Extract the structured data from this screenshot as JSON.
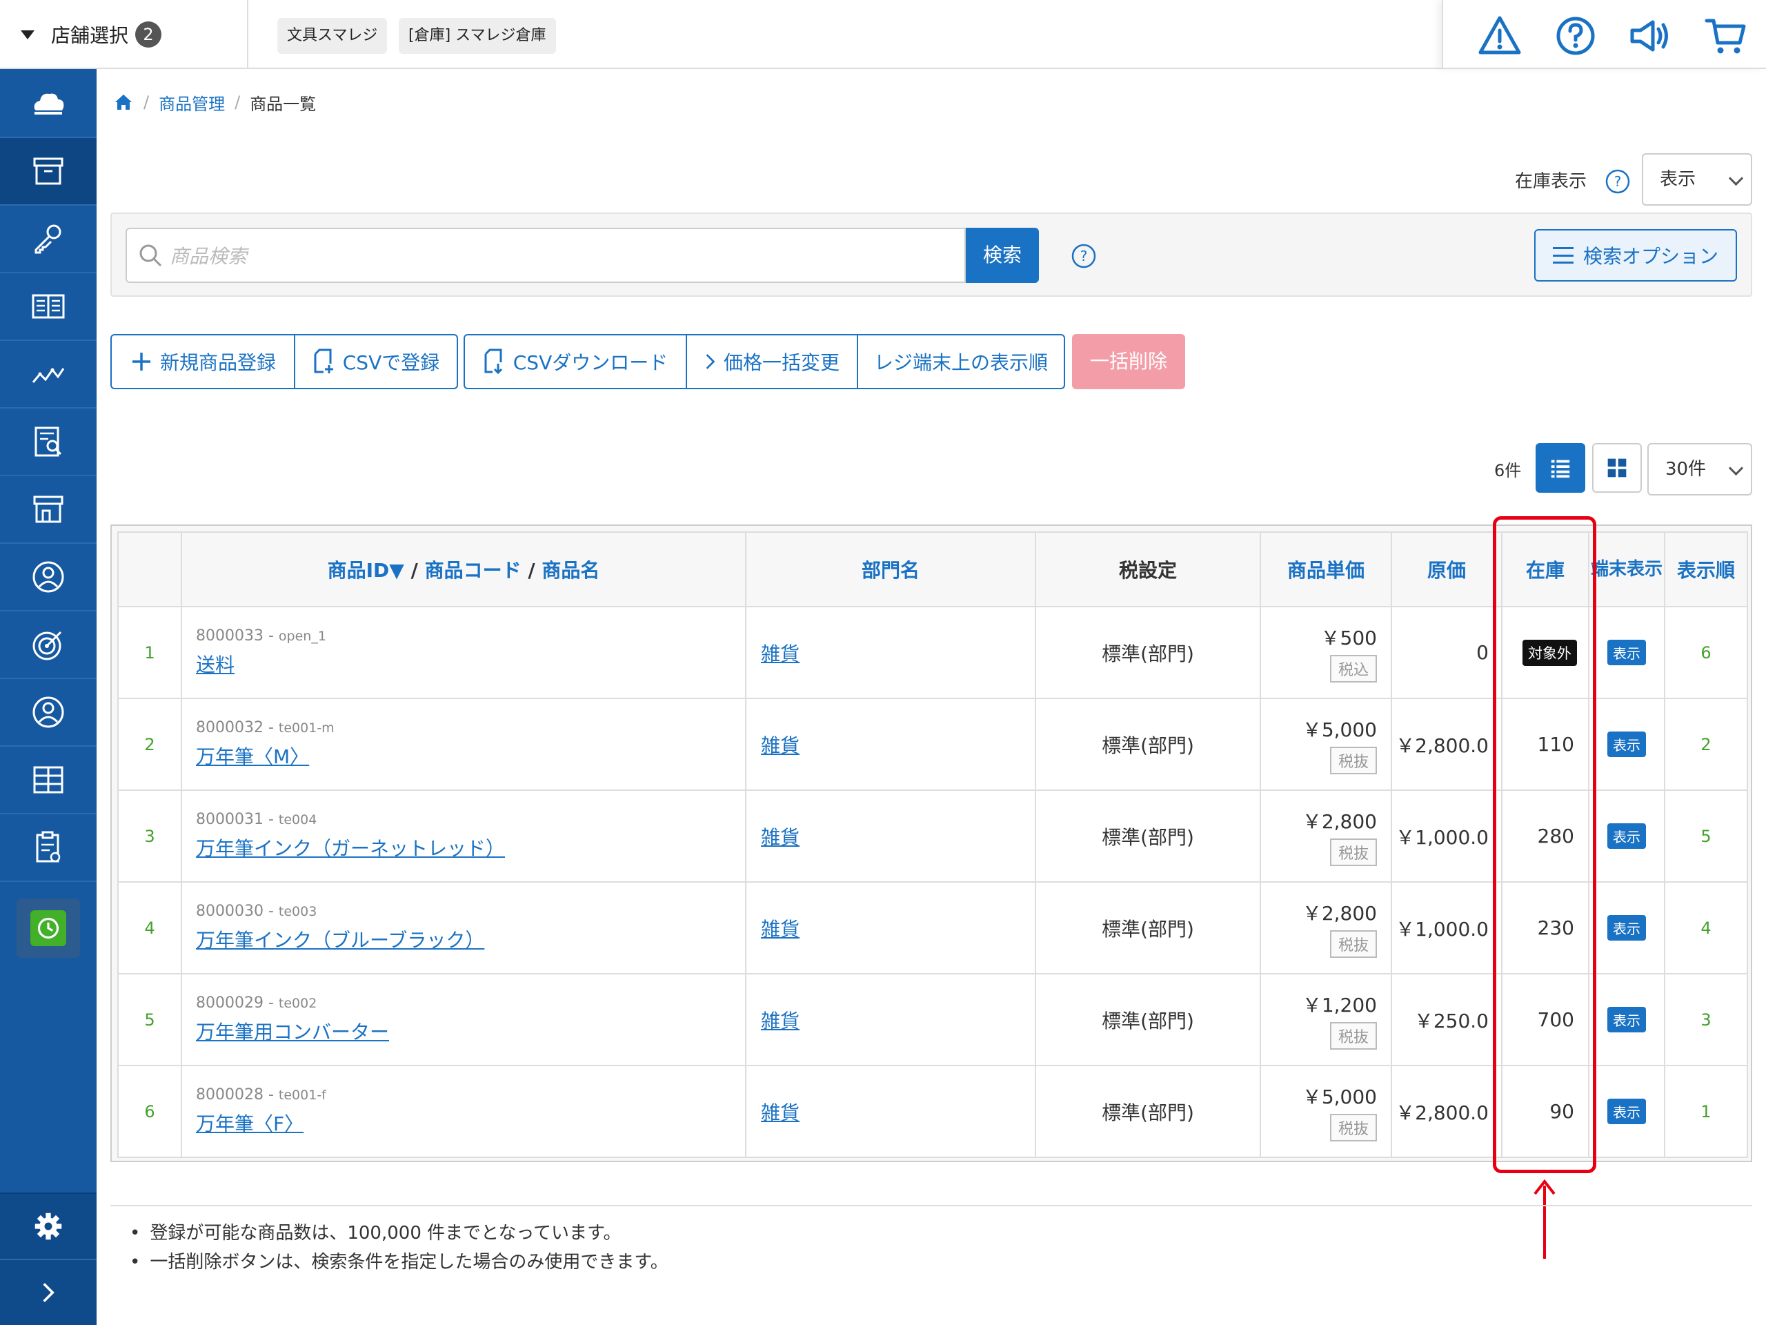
{
  "header": {
    "store_select_label": "店舗選択",
    "store_count": "2",
    "stores": [
      "文具スマレジ",
      "[倉庫] スマレジ倉庫"
    ],
    "icons": [
      "warning-icon",
      "help-icon",
      "announce-icon",
      "cart-icon"
    ]
  },
  "sidebar": {
    "items": [
      "cloud-icon",
      "box-icon",
      "key-icon",
      "book-icon",
      "chart-icon",
      "report-icon",
      "store-icon",
      "staff-icon",
      "target-icon",
      "customer-icon",
      "grid-icon",
      "clipboard-icon",
      "clock-icon"
    ],
    "active": "box-icon",
    "bottom": [
      "gear-icon",
      "chevron-right-icon"
    ]
  },
  "breadcrumb": {
    "home_icon": "home-icon",
    "items": [
      "商品管理",
      "商品一覧"
    ]
  },
  "stock_display": {
    "label": "在庫表示",
    "value": "表示"
  },
  "search": {
    "placeholder": "商品検索",
    "button": "検索",
    "options_button": "検索オプション"
  },
  "actions": {
    "new_product": "新規商品登録",
    "csv_register": "CSVで登録",
    "csv_download": "CSVダウンロード",
    "price_bulk": "価格一括変更",
    "register_order": "レジ端末上の表示順",
    "bulk_delete": "一括削除"
  },
  "list": {
    "count": "6件",
    "per_page": "30件"
  },
  "table": {
    "headers": {
      "id": "商品ID▼",
      "code": "商品コード",
      "name": "商品名",
      "sep": "/",
      "dept": "部門名",
      "tax": "税設定",
      "price": "商品単価",
      "cost": "原価",
      "stock": "在庫",
      "terminal": "端末表示",
      "order": "表示順"
    },
    "rows": [
      {
        "no": "1",
        "id": "8000033",
        "code": "open_1",
        "name": "送料",
        "dept": "雑貨",
        "tax": "標準(部門)",
        "price": "￥500",
        "tax_type": "税込",
        "cost": "0",
        "stock": "",
        "stock_badge": "対象外",
        "terminal": "表示",
        "order": "6"
      },
      {
        "no": "2",
        "id": "8000032",
        "code": "te001-m",
        "name": "万年筆〈M〉",
        "dept": "雑貨",
        "tax": "標準(部門)",
        "price": "￥5,000",
        "tax_type": "税抜",
        "cost": "￥2,800.0",
        "stock": "110",
        "stock_badge": "",
        "terminal": "表示",
        "order": "2"
      },
      {
        "no": "3",
        "id": "8000031",
        "code": "te004",
        "name": "万年筆インク（ガーネットレッド）",
        "dept": "雑貨",
        "tax": "標準(部門)",
        "price": "￥2,800",
        "tax_type": "税抜",
        "cost": "￥1,000.0",
        "stock": "280",
        "stock_badge": "",
        "terminal": "表示",
        "order": "5"
      },
      {
        "no": "4",
        "id": "8000030",
        "code": "te003",
        "name": "万年筆インク（ブルーブラック）",
        "dept": "雑貨",
        "tax": "標準(部門)",
        "price": "￥2,800",
        "tax_type": "税抜",
        "cost": "￥1,000.0",
        "stock": "230",
        "stock_badge": "",
        "terminal": "表示",
        "order": "4"
      },
      {
        "no": "5",
        "id": "8000029",
        "code": "te002",
        "name": "万年筆用コンバーター",
        "dept": "雑貨",
        "tax": "標準(部門)",
        "price": "￥1,200",
        "tax_type": "税抜",
        "cost": "￥250.0",
        "stock": "700",
        "stock_badge": "",
        "terminal": "表示",
        "order": "3"
      },
      {
        "no": "6",
        "id": "8000028",
        "code": "te001-f",
        "name": "万年筆〈F〉",
        "dept": "雑貨",
        "tax": "標準(部門)",
        "price": "￥5,000",
        "tax_type": "税抜",
        "cost": "￥2,800.0",
        "stock": "90",
        "stock_badge": "",
        "terminal": "表示",
        "order": "1"
      }
    ]
  },
  "notes": [
    "登録が可能な商品数は、100,000 件までとなっています。",
    "一括削除ボタンは、検索条件を指定した場合のみ使用できます。"
  ],
  "colors": {
    "primary": "#1a72c4",
    "sidebar": "#1659a0",
    "highlight": "#e60012",
    "delete": "#f29da7",
    "order_green": "#43a02a"
  }
}
